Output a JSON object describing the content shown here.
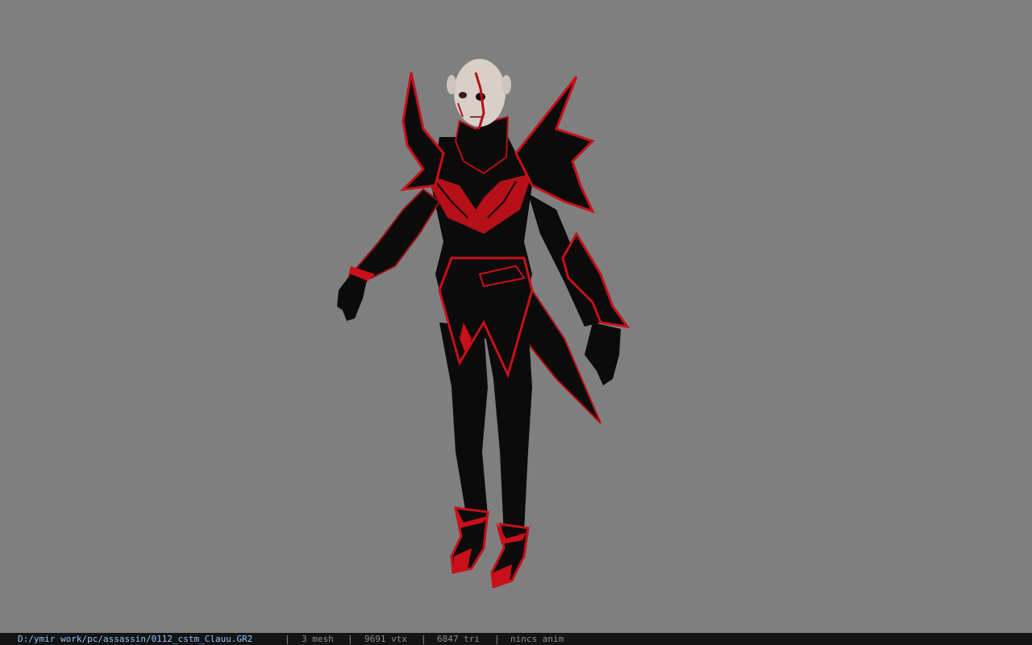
{
  "viewer": {
    "background_color": "#7f7f7f",
    "model": {
      "description_icon": "character-model-icon",
      "armor_color": "#c8101a",
      "body_color": "#0b0b0b",
      "skin_color": "#d8cfc8"
    }
  },
  "statusbar": {
    "file_path": "D:/ymir work/pc/assassin/0112_cstm_Clauu.GR2",
    "separator": "|",
    "mesh_count": "3 mesh",
    "vertex_count": "9691 vtx",
    "triangle_count": "6847 tri",
    "anim_status": "nincs anim"
  }
}
